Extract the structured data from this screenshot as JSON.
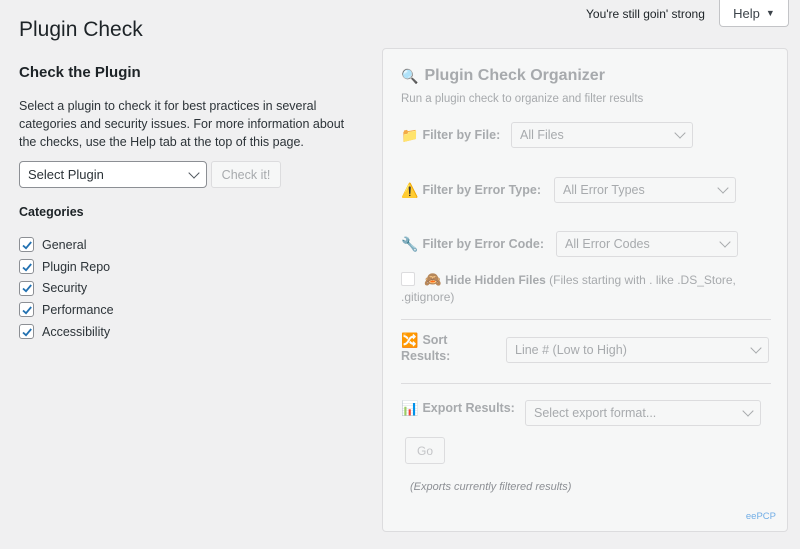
{
  "header": {
    "status_message": "You're still goin' strong",
    "help_label": "Help"
  },
  "page": {
    "title": "Plugin Check"
  },
  "check": {
    "heading": "Check the Plugin",
    "description": "Select a plugin to check it for best practices in several categories and security issues. For more information about the checks, use the Help tab at the top of this page.",
    "select_value": "Select Plugin",
    "check_button": "Check it!",
    "categories_title": "Categories",
    "categories": [
      {
        "label": "General",
        "checked": true
      },
      {
        "label": "Plugin Repo",
        "checked": true
      },
      {
        "label": "Security",
        "checked": true
      },
      {
        "label": "Performance",
        "checked": true
      },
      {
        "label": "Accessibility",
        "checked": true
      }
    ]
  },
  "organizer": {
    "title": "Plugin Check Organizer",
    "title_icon": "magnifier-icon",
    "subtitle": "Run a plugin check to organize and filter results",
    "filter_file_label": "Filter by File:",
    "filter_file_icon": "folder-icon",
    "filter_file_value": "All Files",
    "filter_type_label": "Filter by Error Type:",
    "filter_type_icon": "warning-icon",
    "filter_type_value": "All Error Types",
    "filter_code_label": "Filter by Error Code:",
    "filter_code_icon": "wrench-icon",
    "filter_code_value": "All Error Codes",
    "hide_label": "Hide Hidden Files",
    "hide_icon": "see-no-evil-monkey-icon",
    "hide_note": "(Files starting with . like .DS_Store, .gitignore)",
    "sort_label_1": "Sort",
    "sort_label_2": "Results:",
    "sort_icon": "shuffle-icon",
    "sort_value": "Line # (Low to High)",
    "export_label": "Export Results:",
    "export_icon": "bar-chart-icon",
    "export_placeholder": "Select export format...",
    "go_label": "Go",
    "exports_note": "(Exports currently filtered results)",
    "brand": "eePCP"
  },
  "colors": {
    "accent": "#2271b1",
    "disabled_text": "#a7aaad",
    "background": "#f0f0f1"
  }
}
